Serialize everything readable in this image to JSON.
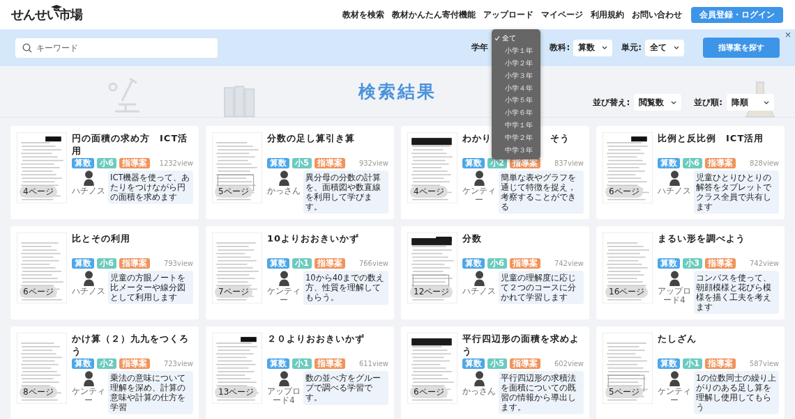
{
  "header": {
    "logo": "せんせい市場",
    "nav": [
      "教材を検索",
      "教材かんたん寄付機能",
      "アップロード",
      "マイページ",
      "利用規約",
      "お問い合わせ"
    ],
    "login_button": "会員登録・ログイン"
  },
  "search": {
    "placeholder": "キーワード",
    "grade_label": "学年",
    "grade_options": [
      {
        "label": "全て",
        "selected": true
      },
      {
        "label": "小学１年",
        "selected": false
      },
      {
        "label": "小学２年",
        "selected": false
      },
      {
        "label": "小学３年",
        "selected": false
      },
      {
        "label": "小学４年",
        "selected": false
      },
      {
        "label": "小学５年",
        "selected": false
      },
      {
        "label": "小学６年",
        "selected": false
      },
      {
        "label": "中学１年",
        "selected": false
      },
      {
        "label": "中学２年",
        "selected": false
      },
      {
        "label": "中学３年",
        "selected": false
      }
    ],
    "subject_label": "教科:",
    "subject_value": "算数",
    "unit_label": "単元:",
    "unit_value": "全て",
    "search_button": "指導案を探す",
    "close": "×"
  },
  "results": {
    "title": "検索結果",
    "sort_label": "並び替え:",
    "sort_value": "閲覧数",
    "order_label": "並び順:",
    "order_value": "降順"
  },
  "cards": [
    {
      "title": "円の面積の求め方　ICT活用",
      "tags": [
        {
          "label": "算数",
          "color": "#4da6e8"
        },
        {
          "label": "小6",
          "color": "#6ccbbf"
        },
        {
          "label": "指導案",
          "color": "#f0945c"
        }
      ],
      "views": "1232view",
      "pages": "4ページ",
      "author": "ハチノス",
      "description": "ICT機器を使って、あたりをつけながら円の面積を求めます"
    },
    {
      "title": "分数の足し算引き算",
      "tags": [
        {
          "label": "算数",
          "color": "#4da6e8"
        },
        {
          "label": "小5",
          "color": "#6ccbbf"
        },
        {
          "label": "指導案",
          "color": "#f0945c"
        }
      ],
      "views": "932view",
      "pages": "5ページ",
      "author": "かっさん",
      "description": "異分母の分数の計算を、面積図や数直線を利用して学びます。"
    },
    {
      "title_parts": [
        "わかり",
        "そう"
      ],
      "tags": [
        {
          "label": "算数",
          "color": "#4da6e8"
        },
        {
          "label": "小2",
          "color": "#6ccbbf"
        },
        {
          "label": "指導案",
          "color": "#f0945c"
        }
      ],
      "views": "837view",
      "pages": "4ページ",
      "author": "ケンティー",
      "description": "簡単な表やグラフを通じて特徴を捉え，考察することができる"
    },
    {
      "title": "比例と反比例　ICT活用",
      "tags": [
        {
          "label": "算数",
          "color": "#4da6e8"
        },
        {
          "label": "小6",
          "color": "#6ccbbf"
        },
        {
          "label": "指導案",
          "color": "#f0945c"
        }
      ],
      "views": "828view",
      "pages": "6ページ",
      "author": "ハチノス",
      "description": "児童ひとりひとりの解答をタブレットでクラス全員で共有します"
    },
    {
      "title": "比とその利用",
      "tags": [
        {
          "label": "算数",
          "color": "#4da6e8"
        },
        {
          "label": "小6",
          "color": "#6ccbbf"
        },
        {
          "label": "指導案",
          "color": "#f0945c"
        }
      ],
      "views": "793view",
      "pages": "6ページ",
      "author": "ハチノス",
      "description": "児童の方眼ノートを比メーターや線分図として利用します"
    },
    {
      "title": "10よりおおきいかず",
      "tags": [
        {
          "label": "算数",
          "color": "#4da6e8"
        },
        {
          "label": "小1",
          "color": "#6ccbbf"
        },
        {
          "label": "指導案",
          "color": "#f0945c"
        }
      ],
      "views": "766view",
      "pages": "7ページ",
      "author": "ケンティー",
      "description": "10から40までの数え方、性質を理解してもらう。"
    },
    {
      "title": "分数",
      "tags": [
        {
          "label": "算数",
          "color": "#4da6e8"
        },
        {
          "label": "小6",
          "color": "#6ccbbf"
        },
        {
          "label": "指導案",
          "color": "#f0945c"
        }
      ],
      "views": "742view",
      "pages": "12ページ",
      "author": "ハチノス",
      "description": "児童の理解度に応じて２つのコースに分かれて学習します"
    },
    {
      "title": "まるい形を調べよう",
      "tags": [
        {
          "label": "算数",
          "color": "#4da6e8"
        },
        {
          "label": "小3",
          "color": "#6ccbbf"
        },
        {
          "label": "指導案",
          "color": "#f0945c"
        }
      ],
      "views": "742view",
      "pages": "16ページ",
      "author": "アップロード4",
      "description": "コンパスを使って、朝顔模様と花びら模様を描く工夫を考えます"
    },
    {
      "title": "かけ算（２）九九をつくろう",
      "tags": [
        {
          "label": "算数",
          "color": "#4da6e8"
        },
        {
          "label": "小2",
          "color": "#6ccbbf"
        },
        {
          "label": "指導案",
          "color": "#f0945c"
        }
      ],
      "views": "723view",
      "pages": "8ページ",
      "author": "ケンティー",
      "description": "乗法の意味について理解を深め、計算の意味や計算の仕方を学習"
    },
    {
      "title": "２０よりおおきいかず",
      "tags": [
        {
          "label": "算数",
          "color": "#4da6e8"
        },
        {
          "label": "小1",
          "color": "#6ccbbf"
        },
        {
          "label": "指導案",
          "color": "#f0945c"
        }
      ],
      "views": "611view",
      "pages": "13ページ",
      "author": "アップロード4",
      "description": "数の並べ方をグループで調べる学習です。"
    },
    {
      "title": "平行四辺形の面積を求めよう",
      "tags": [
        {
          "label": "算数",
          "color": "#4da6e8"
        },
        {
          "label": "小5",
          "color": "#6ccbbf"
        },
        {
          "label": "指導案",
          "color": "#f0945c"
        }
      ],
      "views": "602view",
      "pages": "6ページ",
      "author": "かっさん",
      "description": "平行四辺形の求積法を面積についての既習の情報から導出します。"
    },
    {
      "title": "たしざん",
      "tags": [
        {
          "label": "算数",
          "color": "#4da6e8"
        },
        {
          "label": "小1",
          "color": "#6ccbbf"
        },
        {
          "label": "指導案",
          "color": "#f0945c"
        }
      ],
      "views": "587view",
      "pages": "5ページ",
      "author": "ケンティー",
      "description": "1の位数同士の繰り上がりのある足し算を理解し使用してもらう"
    }
  ]
}
